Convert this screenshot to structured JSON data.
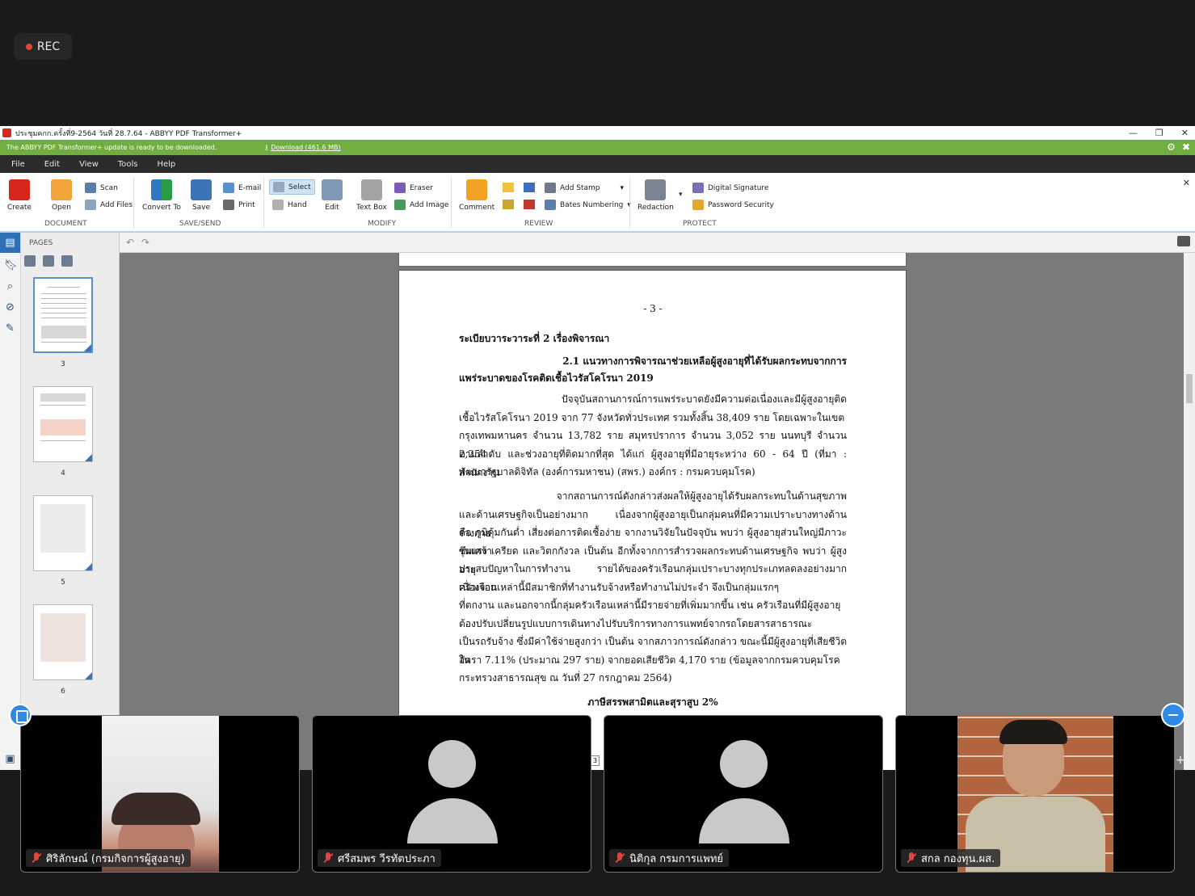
{
  "recording": {
    "label": "REC"
  },
  "window": {
    "title": "ประชุมคกก.ครั้งที่9-2564 วันที่ 28.7.64 - ABBYY PDF Transformer+",
    "controls": [
      "—",
      "❐",
      "✕"
    ]
  },
  "update_bar": {
    "message": "The ABBYY PDF Transformer+ update is ready to be downloaded.",
    "download_label": "Download (461.6 MB)"
  },
  "menu": [
    "File",
    "Edit",
    "View",
    "Tools",
    "Help"
  ],
  "ribbon": {
    "document": {
      "group": "DOCUMENT",
      "create": "Create",
      "open": "Open",
      "scan": "Scan",
      "add_files": "Add Files"
    },
    "save_send": {
      "group": "SAVE/SEND",
      "convert_to": "Convert To",
      "save": "Save",
      "email": "E-mail",
      "print": "Print"
    },
    "modify": {
      "group": "MODIFY",
      "select": "Select",
      "hand": "Hand",
      "edit": "Edit",
      "text_box": "Text Box",
      "eraser": "Eraser",
      "add_image": "Add Image"
    },
    "review": {
      "group": "REVIEW",
      "comment": "Comment",
      "add_stamp": "Add Stamp",
      "bates_numbering": "Bates Numbering"
    },
    "protect": {
      "group": "PROTECT",
      "redaction": "Redaction",
      "digital_signature": "Digital Signature",
      "password_security": "Password Security"
    }
  },
  "pages_panel": {
    "header": "PAGES",
    "thumbnails": [
      "3",
      "4",
      "5",
      "6"
    ]
  },
  "document": {
    "page_number": "- 3 -",
    "agenda": "ระเบียบวาระวาระที่  2  เรื่องพิจารณา",
    "heading_line1": "2.1  แนวทางการพิจารณาช่วยเหลือผู้สูงอายุที่ได้รับผลกระทบจากการ",
    "heading_line2": "แพร่ระบาดของโรคติดเชื้อไวรัสโคโรนา 2019",
    "para1": [
      "ปัจจุบันสถานการณ์การแพร่ระบาดยังมีความต่อเนื่องและมีผู้สูงอายุติด",
      "เชื้อไวรัสโคโรนา 2019 จาก 77 จังหวัดทั่วประเทศ รวมทั้งสิ้น 38,409 ราย โดยเฉพาะในเขต",
      "กรุงเทพมหานคร จำนวน 13,782 ราย  สมุทรปราการ จำนวน 3,052 ราย นนทบุรี จำนวน 2,254",
      "ตามลำดับ และช่วงอายุที่ติดมากที่สุด ได้แก่ ผู้สูงอายุที่มีอายุระหว่าง 60 - 64 ปี (ที่มา : สำนักงาน",
      "พัฒนารัฐบาลดิจิทัล (องค์การมหาชน) (สพร.) องค์กร : กรมควบคุมโรค)"
    ],
    "para2": [
      "จากสถานการณ์ดังกล่าวส่งผลให้ผู้สูงอายุได้รับผลกระทบในด้านสุขภาพ",
      "และด้านเศรษฐกิจเป็นอย่างมาก เนื่องจากผู้สูงอายุเป็นกลุ่มคนที่มีความเปราะบางทางด้านร่างกาย",
      "คือ ภูมิคุ้มกันต่ำ เสี่ยงต่อการติดเชื้อง่าย จากงานวิจัยในปัจจุบัน พบว่า ผู้สูงอายุส่วนใหญ่มีภาวะซึมเศร้า",
      "รุนแรง เครียด และวิตกกังวล เป็นต้น อีกทั้งจากการสำรวจผลกระทบด้านเศรษฐกิจ พบว่า ผู้สูงอายุ",
      "ประสบปัญหาในการทำงาน รายได้ของครัวเรือนกลุ่มเปราะบางทุกประเภทลดลงอย่างมาก เนื่องจาก",
      "ครัวเรือนเหล่านี้มีสมาชิกที่ทำงานรับจ้างหรือทำงานไม่ประจำ จึงเป็นกลุ่มแรกๆ",
      "ที่ตกงาน และนอกจากนี้กลุ่มครัวเรือนเหล่านี้มีรายจ่ายที่เพิ่มมากขึ้น เช่น ครัวเรือนที่มีผู้สูงอายุ",
      "ต้องปรับเปลี่ยนรูปแบบการเดินทางไปรับบริการทางการแพทย์จากรถโดยสารสาธารณะ",
      "เป็นรถรับจ้าง ซึ่งมีค่าใช้จ่ายสูงกว่า เป็นต้น จากสภาวการณ์ดังกล่าว ขณะนี้มีผู้สูงอายุที่เสียชีวิตใน",
      "อัตรา 7.11% (ประมาณ 297 ราย) จากยอดเสียชีวิต 4,170 ราย (ข้อมูลจากกรมควบคุมโรค",
      "กระทรวงสาธารณสุข ณ วันที่ 27 กรกฎาคม 2564)"
    ],
    "subheading": "ภาษีสรรพสามิตและสุราสูบ 2%",
    "page_field": "3"
  },
  "participants": [
    {
      "name": "ศิริลักษณ์  (กรมกิจการผู้สูงอายุ)",
      "video": true
    },
    {
      "name": "ศรีสมพร วีรทัตประภา",
      "video": false
    },
    {
      "name": "นิติกุล กรมการแพทย์",
      "video": false
    },
    {
      "name": "สกล กองทุน.ผส.",
      "video": true
    }
  ]
}
